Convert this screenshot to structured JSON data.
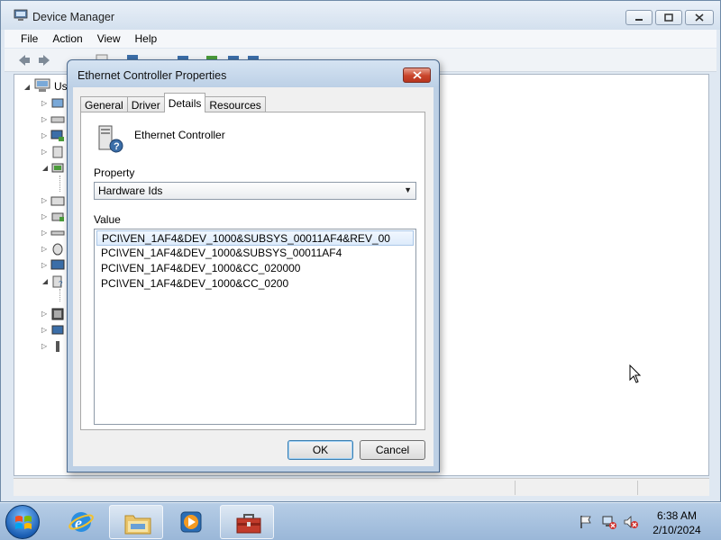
{
  "main_window": {
    "title": "Device Manager",
    "menu": [
      "File",
      "Action",
      "View",
      "Help"
    ],
    "tree_root_label": "Use"
  },
  "dialog": {
    "title": "Ethernet Controller Properties",
    "tabs": [
      "General",
      "Driver",
      "Details",
      "Resources"
    ],
    "active_tab": "Details",
    "device_name": "Ethernet Controller",
    "property_label": "Property",
    "property_selected": "Hardware Ids",
    "value_label": "Value",
    "values": [
      "PCI\\VEN_1AF4&DEV_1000&SUBSYS_00011AF4&REV_00",
      "PCI\\VEN_1AF4&DEV_1000&SUBSYS_00011AF4",
      "PCI\\VEN_1AF4&DEV_1000&CC_020000",
      "PCI\\VEN_1AF4&DEV_1000&CC_0200"
    ],
    "ok_label": "OK",
    "cancel_label": "Cancel"
  },
  "taskbar": {
    "clock_time": "6:38 AM",
    "clock_date": "2/10/2024",
    "pinned": [
      "internet-explorer",
      "windows-explorer",
      "media-player",
      "device-manager"
    ]
  },
  "colors": {
    "title_close_red": "#c9442b",
    "selection_blue": "#ddebfb",
    "taskbar_blue": "#9ab7d8"
  }
}
